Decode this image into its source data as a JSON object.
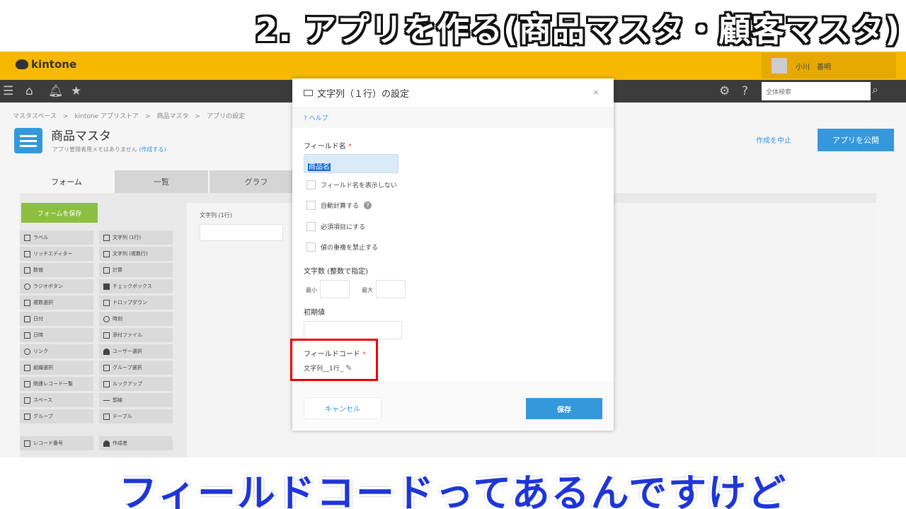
{
  "banner": {
    "title": "2. アプリを作る(商品マスタ・顧客マスタ)"
  },
  "subtitle": {
    "text": "フィールドコードってあるんですけど"
  },
  "header": {
    "logo": "kintone",
    "user": "小川　善明"
  },
  "nav": {
    "search_placeholder": "全体検索"
  },
  "breadcrumb": "マスタスペース　>　kintone アプリストア　>　商品マスタ　>　アプリの設定",
  "app": {
    "title": "商品マスタ",
    "memo": "アプリ管理者用メモはありません",
    "memo_link": "(作成する)",
    "cancel_create": "作成を中止",
    "publish": "アプリを公開"
  },
  "tabs": [
    {
      "label": "フォーム"
    },
    {
      "label": "一覧"
    },
    {
      "label": "グラフ"
    }
  ],
  "form": {
    "save_form": "フォームを保存",
    "canvas_label": "文字列 (1行)"
  },
  "palette": [
    {
      "label": "ラベル"
    },
    {
      "label": "文字列 (1行)"
    },
    {
      "label": "リッチエディター"
    },
    {
      "label": "文字列 (複数行)"
    },
    {
      "label": "数値"
    },
    {
      "label": "計算"
    },
    {
      "label": "ラジオボタン"
    },
    {
      "label": "チェックボックス"
    },
    {
      "label": "複数選択"
    },
    {
      "label": "ドロップダウン"
    },
    {
      "label": "日付"
    },
    {
      "label": "時刻"
    },
    {
      "label": "日時"
    },
    {
      "label": "添付ファイル"
    },
    {
      "label": "リンク"
    },
    {
      "label": "ユーザー選択"
    },
    {
      "label": "組織選択"
    },
    {
      "label": "グループ選択"
    },
    {
      "label": "関連レコード一覧"
    },
    {
      "label": "ルックアップ"
    },
    {
      "label": "スペース"
    },
    {
      "label": "罫線"
    },
    {
      "label": "グループ"
    },
    {
      "label": "テーブル"
    },
    {
      "label": "レコード番号"
    },
    {
      "label": "作成者"
    }
  ],
  "modal": {
    "title": "文字列（１行）の設定",
    "close": "×",
    "help": "? ヘルプ",
    "field_name_label": "フィールド名",
    "required_mark": "*",
    "field_name_value": "商品名",
    "checkboxes": [
      {
        "label": "フィールド名を表示しない"
      },
      {
        "label": "自動計算する"
      },
      {
        "label": "必須項目にする"
      },
      {
        "label": "値の重複を禁止する"
      }
    ],
    "length_label": "文字数 (整数で指定)",
    "min_label": "最小",
    "max_label": "最大",
    "default_label": "初期値",
    "field_code_label": "フィールドコード",
    "field_code_value": "文字列__1行_",
    "cancel": "キャンセル",
    "save": "保存"
  }
}
